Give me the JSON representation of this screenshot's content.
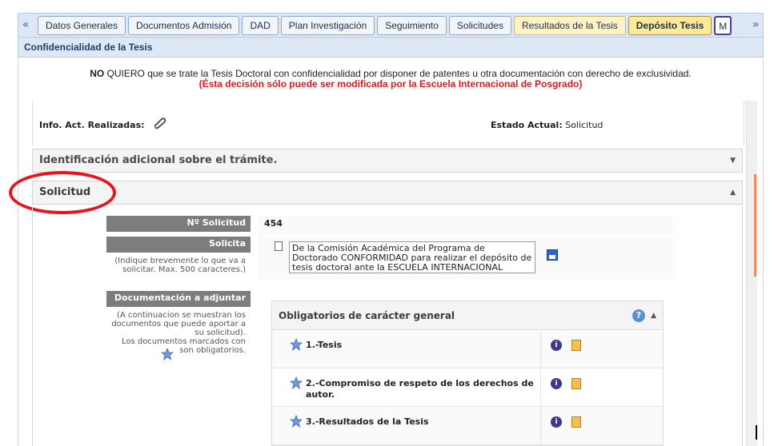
{
  "tabs": [
    {
      "label": "Datos Generales",
      "style": "normal"
    },
    {
      "label": "Documentos Admisión",
      "style": "normal"
    },
    {
      "label": "DAD",
      "style": "normal"
    },
    {
      "label": "Plan Investigación",
      "style": "normal"
    },
    {
      "label": "Seguimiento",
      "style": "normal"
    },
    {
      "label": "Solicitudes",
      "style": "normal"
    },
    {
      "label": "Resultados de la Tesis",
      "style": "yellow"
    },
    {
      "label": "Depósito Tesis",
      "style": "active"
    },
    {
      "label": "M",
      "style": "partial"
    }
  ],
  "nav": {
    "prev_glyph": "«",
    "next_glyph": "»"
  },
  "confidencialidad": {
    "header": "Confidencialidad de la Tesis",
    "no_label": "NO",
    "line1_rest": " QUIERO que se trate la Tesis Doctoral con confidencialidad por disponer de patentes u otra documentación con derecho de exclusividad.",
    "line2": "(Ésta decisión sólo puede ser modificada por la Escuela Internacional de Posgrado)"
  },
  "info": {
    "act_label": "Info. Act. Realizadas:",
    "estado_label": "Estado Actual:",
    "estado_value": "Solicitud"
  },
  "accordions": {
    "identificacion": "Identificación adicional sobre el trámite.",
    "solicitud": "Solicitud"
  },
  "form": {
    "nro_label": "Nº Solicitud",
    "nro_value": "454",
    "solicita_label": "Solicita",
    "solicita_hint": "(Indique brevemente lo que va a solicitar. Max. 500 caracteres.)",
    "solicita_value": "De la Comisión Académica del Programa de Doctorado CONFORMIDAD para realizar el depósito de tesis doctoral ante la ESCUELA INTERNACIONAL",
    "doc_label": "Documentación a adjuntar",
    "doc_hint_1": "(A continuacion se muestran los documentos que puede aportar a su solicitud).",
    "doc_hint_2": "Los documentos marcados con",
    "doc_hint_3": "son obligatorios."
  },
  "obligatorios": {
    "title": "Obligatorios de carácter general",
    "items": [
      {
        "label": "1.-Tesis"
      },
      {
        "label": "2.-Compromiso de respeto de los derechos de autor."
      },
      {
        "label": "3.-Resultados de la Tesis"
      }
    ]
  },
  "colors": {
    "accent_blue": "#2d6db5",
    "alert_red": "#e8141b",
    "label_gray": "#7d7d7d",
    "active_tab": "#fde99a"
  },
  "icons": [
    "prev-arrow-icon",
    "next-arrow-icon",
    "paperclip-icon",
    "document-icon",
    "save-icon",
    "star-icon",
    "help-icon",
    "info-icon",
    "file-icon"
  ]
}
